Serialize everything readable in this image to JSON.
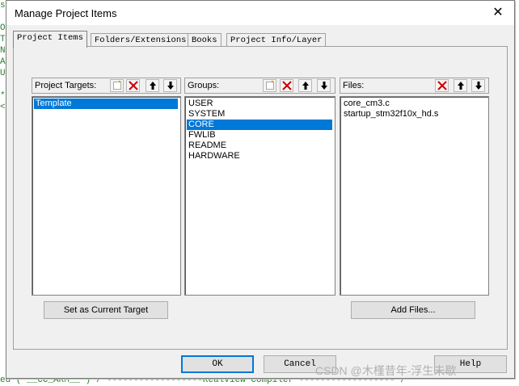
{
  "dialog": {
    "title": "Manage Project Items",
    "close_glyph": "✕",
    "tabs": [
      {
        "label": "Project Items",
        "active": true
      },
      {
        "label": "Folders/Extensions",
        "active": false
      },
      {
        "label": "Books",
        "active": false
      },
      {
        "label": "Project Info/Layer",
        "active": false
      }
    ],
    "targets": {
      "label": "Project Targets:",
      "items": [
        "Template"
      ],
      "selected_index": 0,
      "set_current_label": "Set as Current Target"
    },
    "groups": {
      "label": "Groups:",
      "items": [
        "USER",
        "SYSTEM",
        "CORE",
        "FWLIB",
        "README",
        "HARDWARE"
      ],
      "selected_index": 2
    },
    "files": {
      "label": "Files:",
      "items": [
        "core_cm3.c",
        "startup_stm32f10x_hd.s"
      ],
      "add_files_label": "Add Files..."
    },
    "ok_label": "OK",
    "cancel_label": "Cancel",
    "help_label": "Help"
  },
  "background": {
    "bottom_line": "ed ( __CC_ARM__ ) /*------------------RealView Compiler ------------------*/"
  },
  "watermark": "CSDN @木槿昔年-浮生未歇",
  "icons": [
    "new-item-icon",
    "delete-icon",
    "move-up-icon",
    "move-down-icon",
    "close-icon"
  ],
  "colors": {
    "selection": "#0078d7",
    "delete_red": "#cc0000",
    "default_button_border": "#0078d7"
  }
}
